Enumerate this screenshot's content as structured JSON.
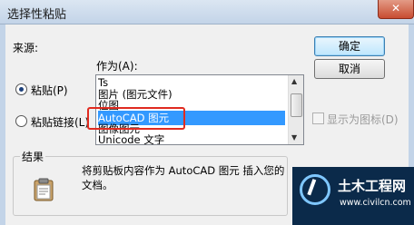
{
  "window": {
    "title": "选择性粘贴",
    "close_glyph": "✕"
  },
  "source": {
    "label": "来源:"
  },
  "paste_as": {
    "label": "作为(A):",
    "items": [
      "Ts",
      "图片 (图元文件)",
      "位图",
      "AutoCAD 图元",
      "图像图元",
      "Unicode 文字"
    ],
    "selected_index": 3
  },
  "options": {
    "paste": "粘贴(P)",
    "paste_link": "粘贴链接(L)",
    "display_as_icon": "显示为图标(D)",
    "selected_radio": "paste"
  },
  "buttons": {
    "ok": "确定",
    "cancel": "取消"
  },
  "result": {
    "label": "结果",
    "text_line1": "将剪贴板内容作为 AutoCAD 图元 插入您的",
    "text_line2": "文档。"
  },
  "watermark": {
    "text_main": "土木工程网",
    "text_url": "www.civilcn.com"
  },
  "colors": {
    "selection": "#3399ff",
    "highlight_box": "#e02b20"
  }
}
